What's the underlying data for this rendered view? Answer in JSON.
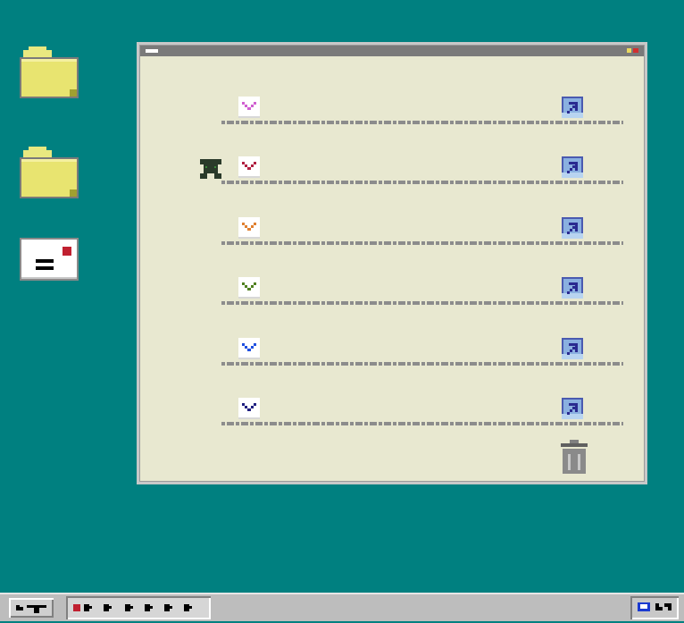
{
  "desktop": {
    "background": "#008080",
    "icons": [
      {
        "name": "folder-icon"
      },
      {
        "name": "folder-icon"
      },
      {
        "name": "mail-icon"
      }
    ]
  },
  "window": {
    "titlebar_color": "#7a7a7a",
    "body_color": "#e8e8d0",
    "mail_rows": [
      {
        "envelope_color": "#d060d0"
      },
      {
        "envelope_color": "#b02040"
      },
      {
        "envelope_color": "#e08030"
      },
      {
        "envelope_color": "#508020"
      },
      {
        "envelope_color": "#2050e0"
      },
      {
        "envelope_color": "#202080"
      }
    ],
    "link_icon": "external-link-icon",
    "trash_icon": "trash-icon"
  },
  "taskbar": {
    "color": "#bdbdbd",
    "task_button_accent": "#c02030"
  }
}
